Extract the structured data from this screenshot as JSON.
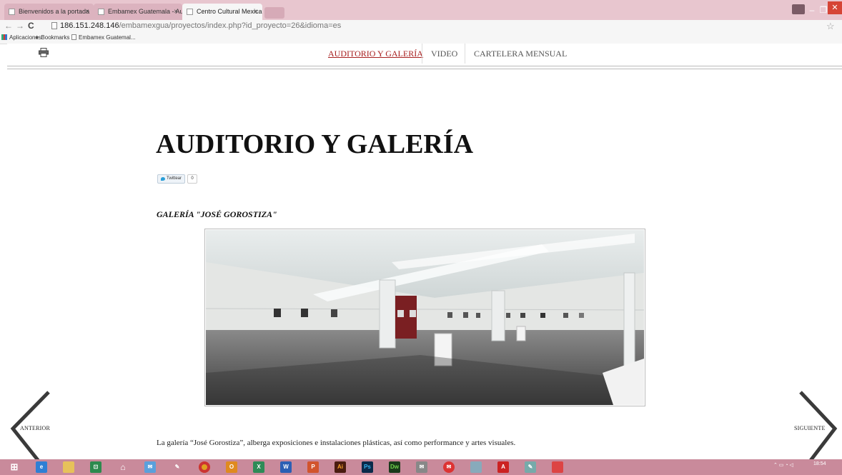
{
  "browser": {
    "tabs": [
      {
        "label": "Bienvenidos a la portada",
        "active": false
      },
      {
        "label": "Embamex Guatemala - Au",
        "active": false
      },
      {
        "label": "Centro Cultural Mexicano",
        "active": true
      }
    ],
    "url_host": "186.151.248.146",
    "url_path": "/embamexgua/proyectos/index.php?id_proyecto=26&idioma=es",
    "bookmarks": [
      "Aplicaciones",
      "Bookmarks",
      "Embamex Guatemal..."
    ]
  },
  "site_nav": {
    "items": [
      {
        "label": "AUDITORIO Y GALERÍA",
        "active": true
      },
      {
        "label": "VIDEO",
        "active": false
      },
      {
        "label": "CARTELERA MENSUAL",
        "active": false
      }
    ]
  },
  "content": {
    "title": "AUDITORIO Y GALERÍA",
    "tweet_label": "Twittear",
    "tweet_count": "0",
    "section_title": "GALERÍA \"JOSÉ GOROSTIZA\"",
    "description": "La galería “José Gorostiza”, alberga exposiciones e instalaciones plásticas, así como performance y artes visuales."
  },
  "pager": {
    "prev_label": "ANTERIOR",
    "next_label": "SIGUIENTE"
  },
  "taskbar": {
    "clock_time": "18:54",
    "icons": [
      "windows-start",
      "internet-explorer",
      "file-explorer",
      "store",
      "home",
      "outlook-mail",
      "paint",
      "chrome",
      "outlook",
      "excel",
      "word",
      "powerpoint",
      "illustrator",
      "photoshop",
      "dreamweaver",
      "mail-app",
      "mail-red",
      "notes",
      "acrobat",
      "paint-app",
      "paint-red"
    ]
  },
  "colors": {
    "chrome_pink": "#e8c6cf",
    "taskbar_pink": "#c98a9b",
    "nav_active": "#a82020"
  }
}
